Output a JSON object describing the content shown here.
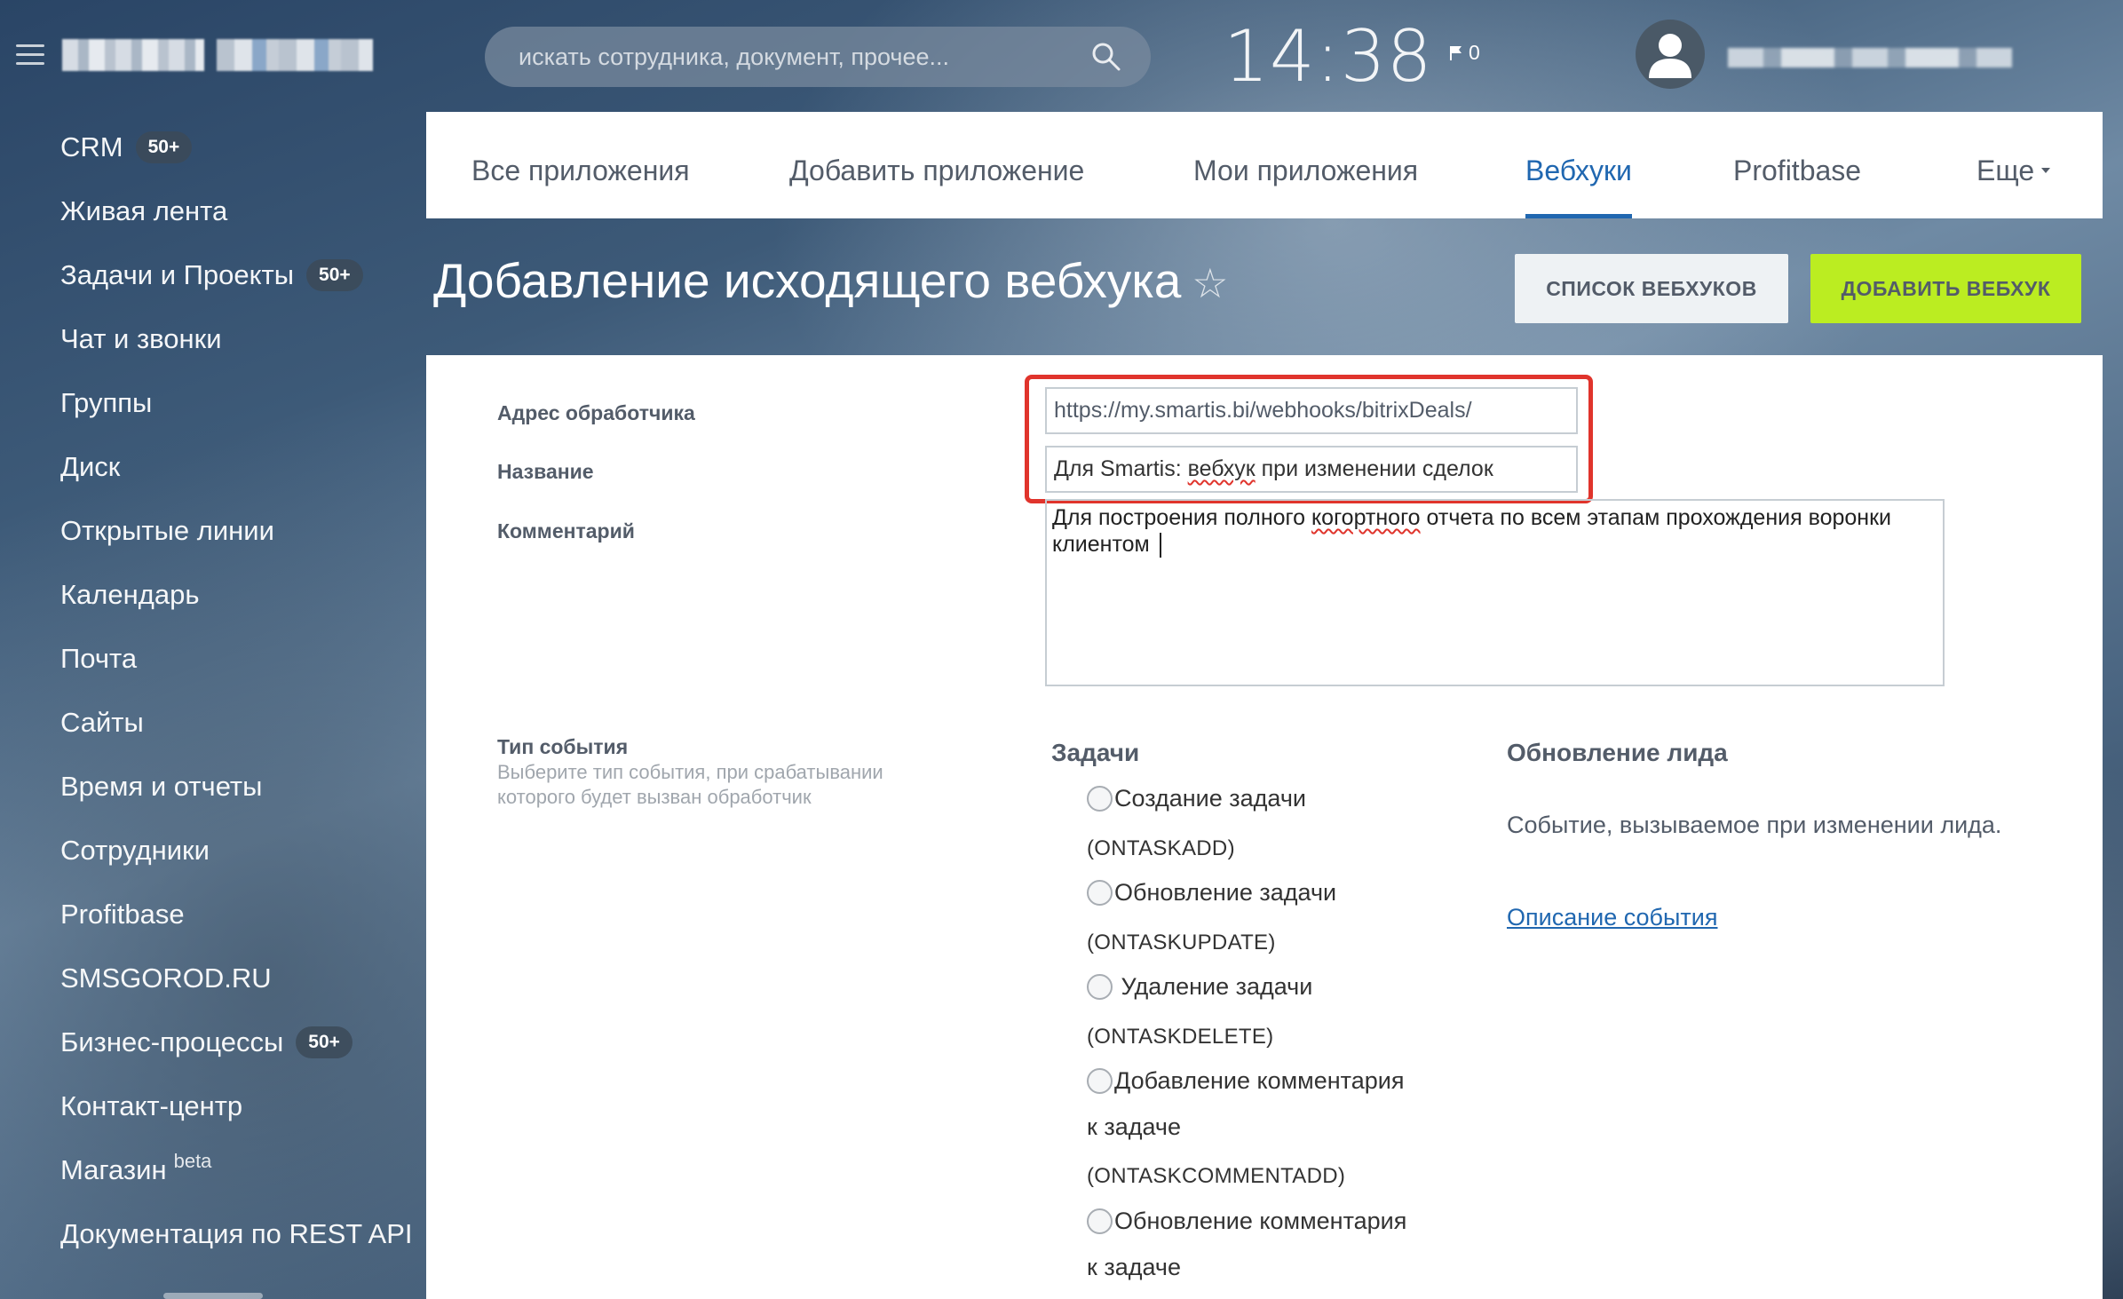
{
  "header": {
    "search_placeholder": "искать сотрудника, документ, прочее...",
    "clock": "14:38",
    "notifications_count": "0"
  },
  "left_menu": [
    {
      "label": "CRM",
      "badge": "50+"
    },
    {
      "label": "Живая лента",
      "badge": ""
    },
    {
      "label": "Задачи и Проекты",
      "badge": "50+"
    },
    {
      "label": "Чат и звонки",
      "badge": ""
    },
    {
      "label": "Группы",
      "badge": ""
    },
    {
      "label": "Диск",
      "badge": ""
    },
    {
      "label": "Открытые линии",
      "badge": ""
    },
    {
      "label": "Календарь",
      "badge": ""
    },
    {
      "label": "Почта",
      "badge": ""
    },
    {
      "label": "Сайты",
      "badge": ""
    },
    {
      "label": "Время и отчеты",
      "badge": ""
    },
    {
      "label": "Сотрудники",
      "badge": ""
    },
    {
      "label": "Profitbase",
      "badge": ""
    },
    {
      "label": "SMSGOROD.RU",
      "badge": ""
    },
    {
      "label": "Бизнес-процессы",
      "badge": "50+"
    },
    {
      "label": "Контакт-центр",
      "badge": ""
    },
    {
      "label": "Магазин",
      "sup": "beta"
    },
    {
      "label": "Документация по REST API",
      "badge": ""
    }
  ],
  "tabs": [
    {
      "label": "Все приложения"
    },
    {
      "label": "Добавить приложение"
    },
    {
      "label": "Мои приложения"
    },
    {
      "label": "Вебхуки",
      "active": true
    },
    {
      "label": "Profitbase"
    },
    {
      "label": "Еще"
    }
  ],
  "page": {
    "title": "Добавление исходящего вебхука",
    "star_icon": "☆",
    "list_button": "СПИСОК ВЕБХУКОВ",
    "add_button": "ДОБАВИТЬ ВЕБХУК"
  },
  "form": {
    "handler_label": "Адрес обработчика",
    "handler_value": "https://my.smartis.bi/webhooks/bitrixDeals/",
    "name_label": "Название",
    "name_value_pre": "Для Smartis: ",
    "name_value_squig": "вебхук",
    "name_value_post": " при изменении сделок",
    "comment_label": "Комментарий",
    "comment_pre": "Для построения полного ",
    "comment_squig": "когортного",
    "comment_post": " отчета по всем этапам прохождения воронки клиентом ",
    "event_type_label": "Тип события",
    "event_type_hint": "Выберите тип события, при срабатывании которого будет вызван обработчик",
    "events_group_title": "Задачи",
    "events": [
      {
        "label": "Создание задачи",
        "code": "(ONTASKADD)"
      },
      {
        "label": "Обновление задачи",
        "code": "(ONTASKUPDATE)"
      },
      {
        "label": " Удаление задачи",
        "code": "(ONTASKDELETE)"
      },
      {
        "label": "Добавление комментария",
        "label2": "к задаче",
        "code": "(ONTASKCOMMENTADD)"
      },
      {
        "label": "Обновление комментария",
        "label2": "к задаче"
      }
    ],
    "side_title": "Обновление лида",
    "side_desc": "Событие, вызываемое при изменении лида.",
    "side_link": "Описание события"
  },
  "colors": {
    "accent_blue": "#2067b0",
    "add_button_green": "#bbed21",
    "highlight_red": "#e0342c"
  }
}
